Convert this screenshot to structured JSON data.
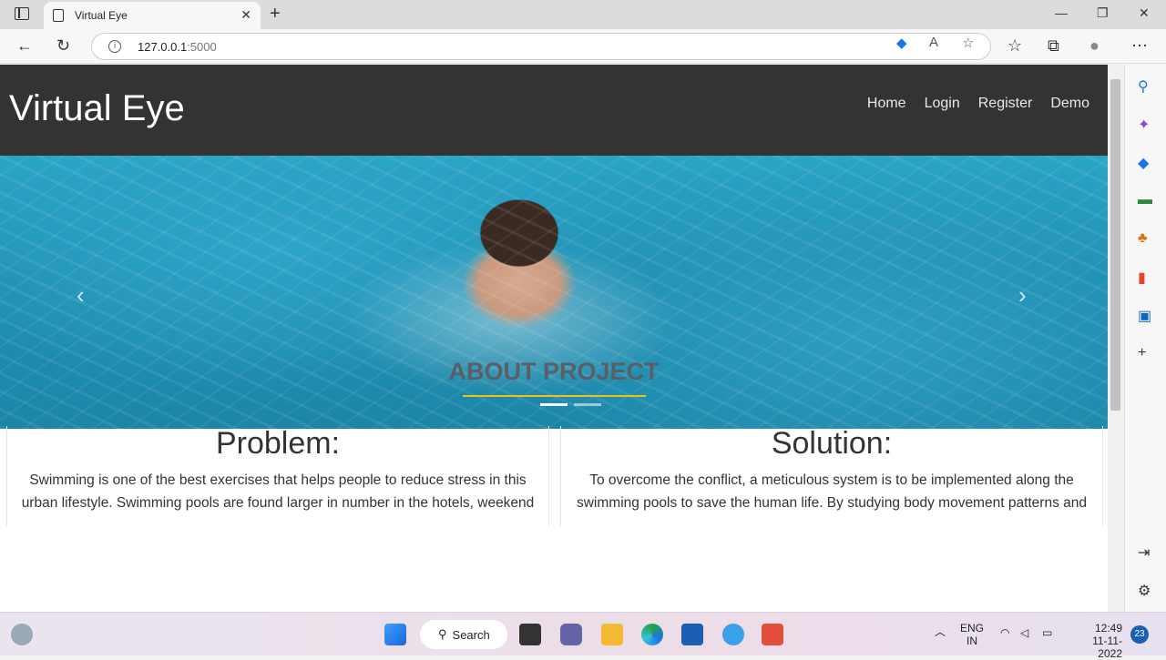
{
  "browser": {
    "tab_title": "Virtual Eye",
    "close_tab": "✕",
    "new_tab": "+",
    "url_host": "127.0.0.1",
    "url_port": ":5000",
    "window_controls": {
      "minimize": "—",
      "restore": "❐",
      "close": "✕"
    }
  },
  "site": {
    "brand": "Virtual Eye",
    "menu": [
      "Home",
      "Login",
      "Register",
      "Demo"
    ]
  },
  "carousel": {
    "prev": "‹",
    "next": "›",
    "slide_count": 2,
    "active_index": 0
  },
  "about": {
    "heading": "ABOUT PROJECT",
    "underline_color": "#f2c118",
    "problem": {
      "title": "Problem:",
      "text": "Swimming is one of the best exercises that helps people to reduce stress in this urban lifestyle. Swimming pools are found larger in number in the hotels, weekend"
    },
    "solution": {
      "title": "Solution:",
      "text": "To overcome the conflict, a meticulous system is to be implemented along the swimming pools to save the human life. By studying body movement patterns and"
    }
  },
  "taskbar": {
    "search_label": "Search",
    "lang_top": "ENG",
    "lang_bottom": "IN",
    "time": "12:49",
    "date": "11-11-2022",
    "notification_count": "23"
  },
  "colors": {
    "header_bg": "#333333",
    "accent_yellow": "#f2c118"
  }
}
